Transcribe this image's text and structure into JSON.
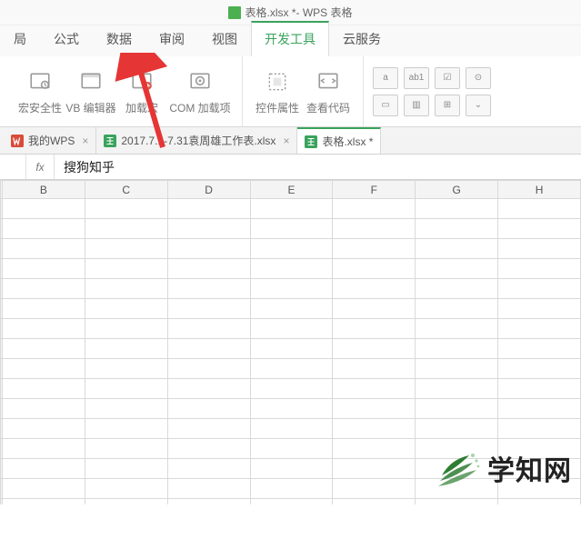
{
  "title": {
    "doc": "表格.xlsx *",
    "app": " - WPS 表格"
  },
  "menu": {
    "tabs": [
      "局",
      "公式",
      "数据",
      "审阅",
      "视图",
      "开发工具",
      "云服务"
    ],
    "active_index": 5,
    "highlight_index": 2
  },
  "ribbon": {
    "items": [
      {
        "label": "宏安全性",
        "icon": "shield"
      },
      {
        "label": "VB 编辑器",
        "icon": "vb"
      },
      {
        "label": "加载宏",
        "icon": "macro"
      },
      {
        "label": "COM 加载项",
        "icon": "com"
      }
    ],
    "props": [
      {
        "label": "控件属性",
        "icon": "props"
      },
      {
        "label": "查看代码",
        "icon": "code"
      }
    ],
    "smallbtns": [
      "a",
      "ab1",
      "☑",
      "⊙",
      "▭",
      "▥",
      "⊞",
      "⌄"
    ]
  },
  "doctabs": [
    {
      "label": "我的WPS",
      "icon": "wps",
      "closable": true,
      "active": false
    },
    {
      "label": "2017.7.1-7.31袁周雄工作表.xlsx",
      "icon": "xls",
      "closable": true,
      "active": false
    },
    {
      "label": "表格.xlsx *",
      "icon": "xls",
      "closable": false,
      "active": true
    }
  ],
  "formula": {
    "fx": "fx",
    "cellref": "",
    "value": "搜狗知乎"
  },
  "columns": [
    "B",
    "C",
    "D",
    "E",
    "F",
    "G",
    "H"
  ],
  "rows": 16,
  "watermark": {
    "text": "学知网"
  }
}
